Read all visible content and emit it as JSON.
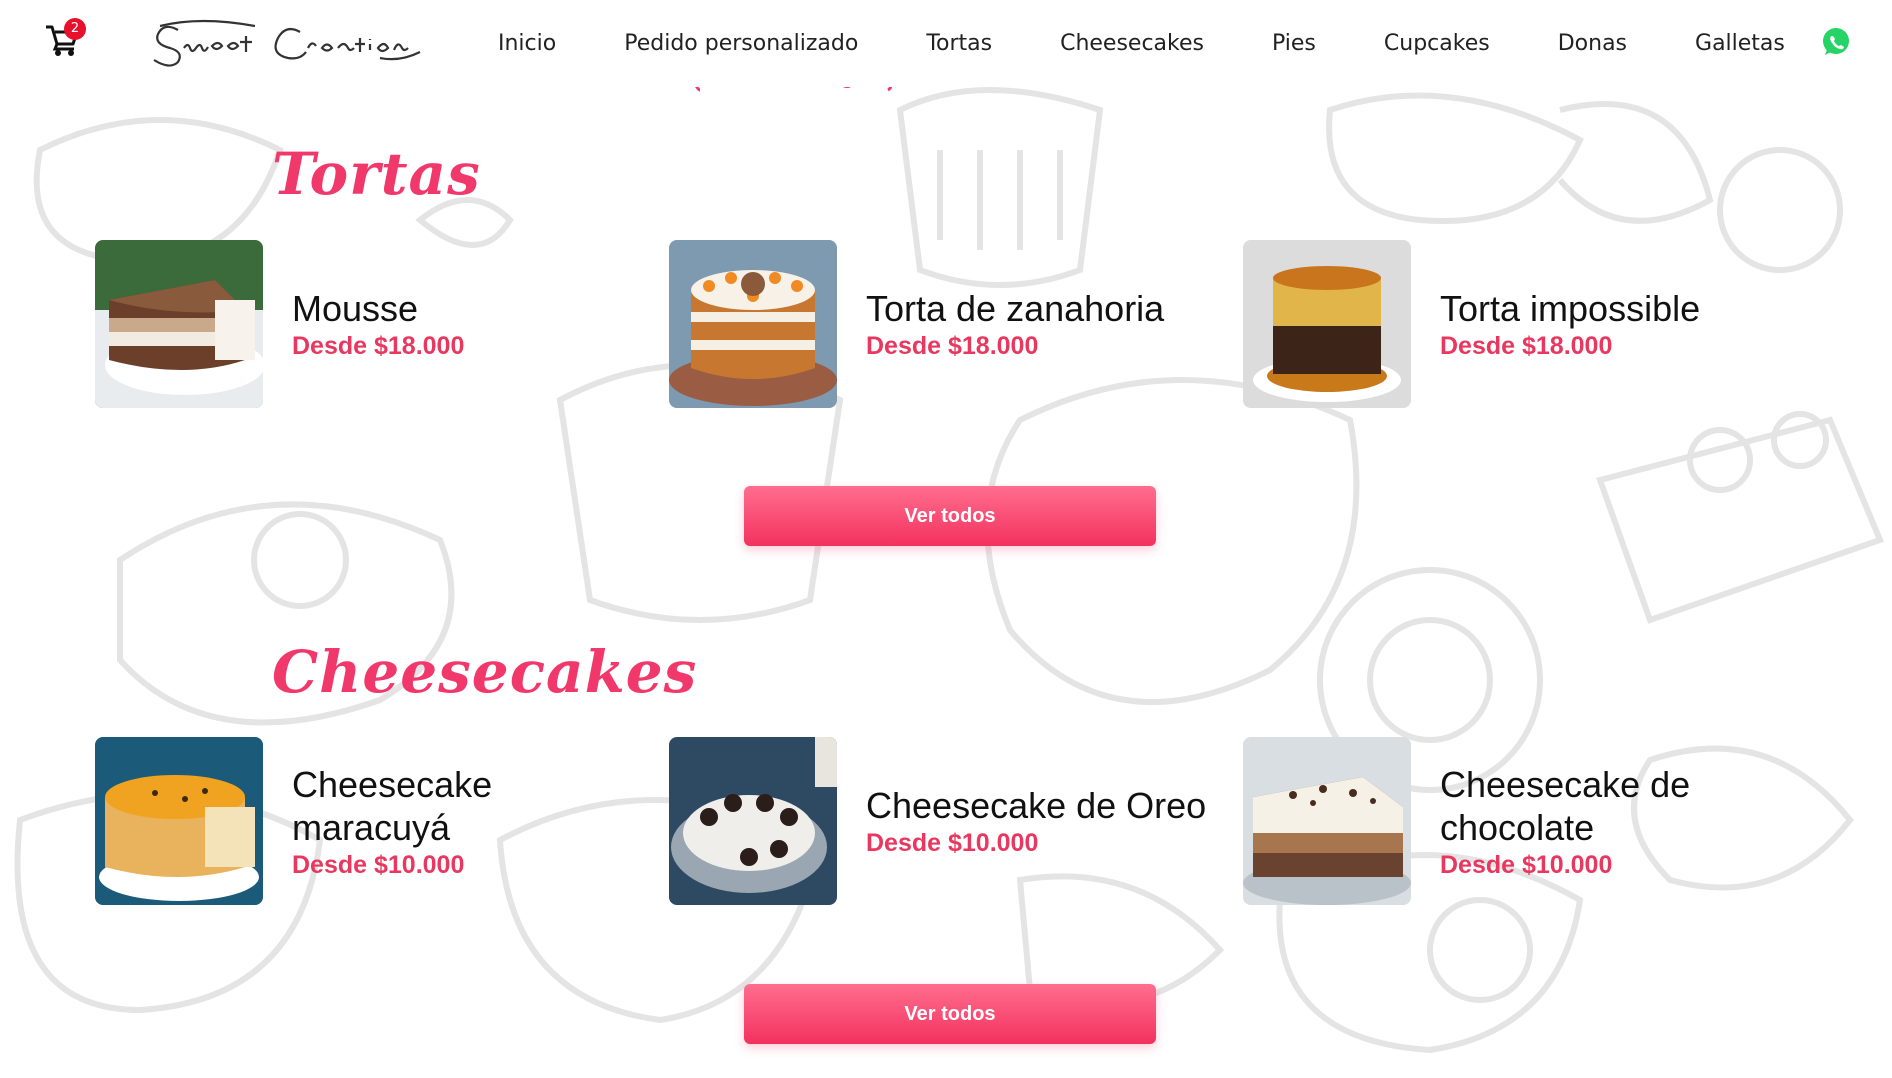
{
  "header": {
    "cart_count": "2",
    "logo_text": "Sweet Creation",
    "nav": [
      "Inicio",
      "Pedido personalizado",
      "Tortas",
      "Cheesecakes",
      "Pies",
      "Cupcakes",
      "Donas",
      "Galletas"
    ],
    "icons": {
      "cart": "shopping-cart-icon",
      "whatsapp": "whatsapp-icon"
    },
    "colors": {
      "accent": "#f0386b",
      "badge": "#e8112d",
      "whatsapp": "#25d366"
    }
  },
  "sections": [
    {
      "title": "Tortas",
      "items": [
        {
          "name": "Mousse",
          "price": "Desde $18.000"
        },
        {
          "name": "Torta de zanahoria",
          "price": "Desde $18.000"
        },
        {
          "name": "Torta impossible",
          "price": "Desde $18.000"
        }
      ],
      "button": "Ver todos"
    },
    {
      "title": "Cheesecakes",
      "items": [
        {
          "name": "Cheesecake maracuyá",
          "price": "Desde $10.000"
        },
        {
          "name": "Cheesecake de Oreo",
          "price": "Desde $10.000"
        },
        {
          "name": "Cheesecake de chocolate",
          "price": "Desde $10.000"
        }
      ],
      "button": "Ver todos"
    }
  ]
}
